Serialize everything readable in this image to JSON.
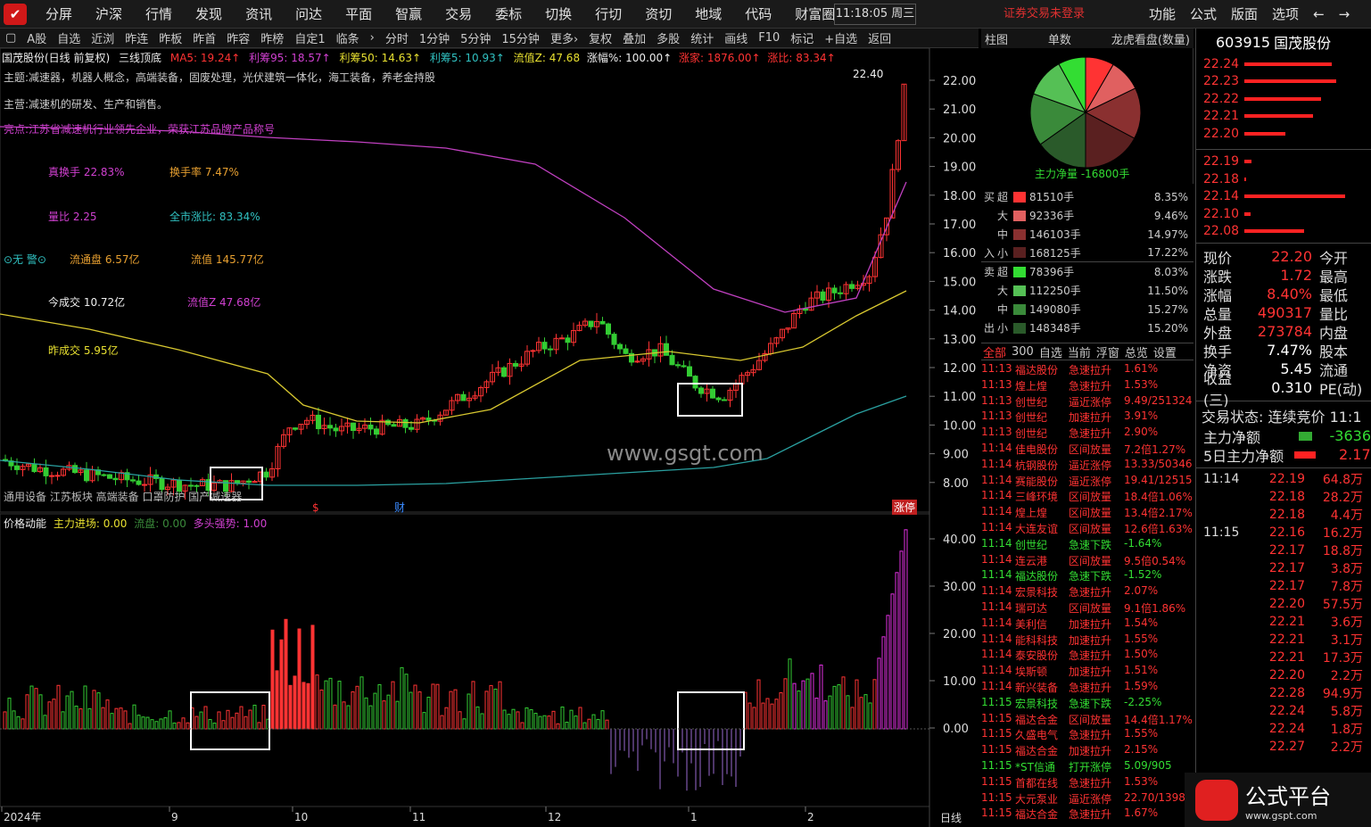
{
  "menubar": {
    "logo": "✔",
    "items": [
      "分屏",
      "沪深",
      "行情",
      "发现",
      "资讯",
      "问达",
      "平面",
      "智赢",
      "交易",
      "委标",
      "切换",
      "行切",
      "资切",
      "地域",
      "代码",
      "财富圈"
    ],
    "clock": "11:18:05 周三",
    "alert": "证券交易未登录",
    "right": [
      "功能",
      "公式",
      "版面",
      "选项",
      "←",
      "→"
    ]
  },
  "toolbar": {
    "items": [
      "▢",
      "A股",
      "自选",
      "近浏",
      "昨连",
      "昨板",
      "昨首",
      "昨容",
      "昨榜",
      "自定1",
      "临条",
      "›",
      "分时",
      "1分钟",
      "5分钟",
      "15分钟",
      "更多›",
      "复权",
      "叠加",
      "多股",
      "统计",
      "画线",
      "F10",
      "标记",
      "+自选",
      "返回"
    ]
  },
  "right_tabs": {
    "a": "柱图",
    "b": "单数",
    "c": "龙虎看盘(数量)"
  },
  "chart": {
    "title": "国茂股份(日线 前复权)",
    "indicator": "三线顶底",
    "ma5": "MA5: 19.24↑",
    "lc95": "利筹95: 18.57↑",
    "lc50": "利筹50: 14.63↑",
    "lc5": "利筹5: 10.93↑",
    "ltz": "流值Z: 47.68",
    "zf": "涨幅%: 100.00↑",
    "zj": "涨家: 1876.00↑",
    "zb": "涨比: 83.34↑",
    "theme": "主题:减速器，机器人概念，高端装备，固废处理，光伏建筑一体化，海工装备，养老金持股",
    "business": "主营:减速机的研发、生产和销售。",
    "highlight": "亮点:江苏省减速机行业领先企业，荣获江苏品牌产品称号",
    "zhs": "真换手 22.83%",
    "hsl": "换手率 7.47%",
    "lb": "量比 2.25",
    "qszb": "全市涨比: 83.34%",
    "wj": "⊙无 警⊙",
    "ltp": "流通盘 6.57亿",
    "lz": "流值 145.77亿",
    "jcj": "今成交 10.72亿",
    "lzz": "流值Z 47.68亿",
    "zcj": "昨成交 5.95亿",
    "bottom_label": "通用设备 江苏板块 高端装备 口罩防护 国产减速器",
    "price_max": "22.40",
    "dollar": "$",
    "cai": "财",
    "zt": "涨停",
    "indicator2_name": "价格动能",
    "zljc": "主力进场: 0.00",
    "lp": "流盘: 0.00",
    "dtqs": "多头强势: 1.00",
    "xaxis": [
      "2024年",
      "9",
      "10",
      "11",
      "12",
      "1",
      "2"
    ],
    "period": "日线",
    "yticks": [
      "22.00",
      "21.00",
      "20.00",
      "19.00",
      "18.00",
      "17.00",
      "16.00",
      "15.00",
      "14.00",
      "13.00",
      "12.00",
      "11.00",
      "10.00",
      "9.00",
      "8.00"
    ],
    "yticks2": [
      "40.00",
      "30.00",
      "20.00",
      "10.00",
      "0.00"
    ],
    "watermark": "www.gsgt.com"
  },
  "pie": {
    "caption": "主力净量 -16800手"
  },
  "flow": [
    {
      "side": "买",
      "lv": "超",
      "vol": "81510手",
      "pct": "8.35%",
      "color": "#ff3333"
    },
    {
      "side": "",
      "lv": "大",
      "vol": "92336手",
      "pct": "9.46%",
      "color": "#e06060"
    },
    {
      "side": "",
      "lv": "中",
      "vol": "146103手",
      "pct": "14.97%",
      "color": "#8a3030"
    },
    {
      "side": "入",
      "lv": "小",
      "vol": "168125手",
      "pct": "17.22%",
      "color": "#5a2020"
    },
    {
      "side": "卖",
      "lv": "超",
      "vol": "78396手",
      "pct": "8.03%",
      "color": "#33dd33"
    },
    {
      "side": "",
      "lv": "大",
      "vol": "112250手",
      "pct": "11.50%",
      "color": "#55c055"
    },
    {
      "side": "",
      "lv": "中",
      "vol": "149080手",
      "pct": "15.27%",
      "color": "#3a8a3a"
    },
    {
      "side": "出",
      "lv": "小",
      "vol": "148348手",
      "pct": "15.20%",
      "color": "#2a5a2a"
    }
  ],
  "stock_tabs": [
    "全部",
    "300",
    "自选",
    "当前",
    "浮窗",
    "总览",
    "设置"
  ],
  "news": [
    {
      "t": "11:13",
      "n": "福达股份",
      "a": "急速拉升",
      "v": "1.61%",
      "up": true
    },
    {
      "t": "11:13",
      "n": "煌上煌",
      "a": "急速拉升",
      "v": "1.53%",
      "up": true
    },
    {
      "t": "11:13",
      "n": "创世纪",
      "a": "逼近涨停",
      "v": "9.49/251324",
      "up": true
    },
    {
      "t": "11:13",
      "n": "创世纪",
      "a": "加速拉升",
      "v": "3.91%",
      "up": true
    },
    {
      "t": "11:13",
      "n": "创世纪",
      "a": "急速拉升",
      "v": "2.90%",
      "up": true
    },
    {
      "t": "11:14",
      "n": "佳电股份",
      "a": "区间放量",
      "v": "7.2倍1.27%",
      "up": true
    },
    {
      "t": "11:14",
      "n": "杭钢股份",
      "a": "逼近涨停",
      "v": "13.33/50346",
      "up": true
    },
    {
      "t": "11:14",
      "n": "赛能股份",
      "a": "逼近涨停",
      "v": "19.41/12515",
      "up": true
    },
    {
      "t": "11:14",
      "n": "三峰环境",
      "a": "区间放量",
      "v": "18.4倍1.06%",
      "up": true
    },
    {
      "t": "11:14",
      "n": "煌上煌",
      "a": "区间放量",
      "v": "13.4倍2.17%",
      "up": true
    },
    {
      "t": "11:14",
      "n": "大连友谊",
      "a": "区间放量",
      "v": "12.6倍1.63%",
      "up": true
    },
    {
      "t": "11:14",
      "n": "创世纪",
      "a": "急速下跌",
      "v": "-1.64%",
      "up": false
    },
    {
      "t": "11:14",
      "n": "连云港",
      "a": "区间放量",
      "v": "9.5倍0.54%",
      "up": true
    },
    {
      "t": "11:14",
      "n": "福达股份",
      "a": "急速下跌",
      "v": "-1.52%",
      "up": false
    },
    {
      "t": "11:14",
      "n": "宏景科技",
      "a": "急速拉升",
      "v": "2.07%",
      "up": true
    },
    {
      "t": "11:14",
      "n": "瑞可达",
      "a": "区间放量",
      "v": "9.1倍1.86%",
      "up": true
    },
    {
      "t": "11:14",
      "n": "美利信",
      "a": "加速拉升",
      "v": "1.54%",
      "up": true
    },
    {
      "t": "11:14",
      "n": "能科科技",
      "a": "加速拉升",
      "v": "1.55%",
      "up": true
    },
    {
      "t": "11:14",
      "n": "泰安股份",
      "a": "急速拉升",
      "v": "1.50%",
      "up": true
    },
    {
      "t": "11:14",
      "n": "埃斯顿",
      "a": "加速拉升",
      "v": "1.51%",
      "up": true
    },
    {
      "t": "11:14",
      "n": "新兴装备",
      "a": "急速拉升",
      "v": "1.59%",
      "up": true
    },
    {
      "t": "11:15",
      "n": "宏景科技",
      "a": "急速下跌",
      "v": "-2.25%",
      "up": false
    },
    {
      "t": "11:15",
      "n": "福达合金",
      "a": "区间放量",
      "v": "14.4倍1.17%",
      "up": true
    },
    {
      "t": "11:15",
      "n": "久盛电气",
      "a": "急速拉升",
      "v": "1.55%",
      "up": true
    },
    {
      "t": "11:15",
      "n": "福达合金",
      "a": "加速拉升",
      "v": "2.15%",
      "up": true
    },
    {
      "t": "11:15",
      "n": "*ST信通",
      "a": "打开涨停",
      "v": "5.09/905",
      "up": false
    },
    {
      "t": "11:15",
      "n": "首都在线",
      "a": "急速拉升",
      "v": "1.53%",
      "up": true
    },
    {
      "t": "11:15",
      "n": "大元泵业",
      "a": "逼近涨停",
      "v": "22.70/1398",
      "up": true
    },
    {
      "t": "11:15",
      "n": "福达合金",
      "a": "急速拉升",
      "v": "1.67%",
      "up": true
    }
  ],
  "quote": {
    "code": "603915",
    "name": "国茂股份",
    "asks": [
      {
        "p": "22.24",
        "w": 0.82
      },
      {
        "p": "22.23",
        "w": 0.86
      },
      {
        "p": "22.22",
        "w": 0.72
      },
      {
        "p": "22.21",
        "w": 0.64
      },
      {
        "p": "22.20",
        "w": 0.38
      }
    ],
    "bids": [
      {
        "p": "22.19",
        "w": 0.07
      },
      {
        "p": "22.18",
        "w": 0.02
      },
      {
        "p": "22.14",
        "w": 0.94
      },
      {
        "p": "22.10",
        "w": 0.06
      },
      {
        "p": "22.08",
        "w": 0.56
      }
    ],
    "kv": [
      {
        "k": "现价",
        "v": "22.20",
        "k2": "今开"
      },
      {
        "k": "涨跌",
        "v": "1.72",
        "k2": "最高"
      },
      {
        "k": "涨幅",
        "v": "8.40%",
        "k2": "最低"
      },
      {
        "k": "总量",
        "v": "490317",
        "k2": "量比"
      },
      {
        "k": "外盘",
        "v": "273784",
        "k2": "内盘"
      },
      {
        "k": "换手",
        "v": "7.47%",
        "k2": "股本"
      },
      {
        "k": "净资",
        "v": "5.45",
        "k2": "流通"
      },
      {
        "k": "收益(三)",
        "v": "0.310",
        "k2": "PE(动)"
      }
    ],
    "state": "交易状态: 连续竞价 11:1",
    "zl1": "主力净额",
    "zl1v": "-3636",
    "zl2": "5日主力净额",
    "zl2v": "2.17",
    "ticks": [
      {
        "t": "11:14",
        "p": "22.19",
        "v": "64.8万"
      },
      {
        "t": "",
        "p": "22.18",
        "v": "28.2万"
      },
      {
        "t": "",
        "p": "22.18",
        "v": "4.4万"
      },
      {
        "t": "11:15",
        "p": "22.16",
        "v": "16.2万"
      },
      {
        "t": "",
        "p": "22.17",
        "v": "18.8万"
      },
      {
        "t": "",
        "p": "22.17",
        "v": "3.8万"
      },
      {
        "t": "",
        "p": "22.17",
        "v": "7.8万"
      },
      {
        "t": "",
        "p": "22.20",
        "v": "57.5万"
      },
      {
        "t": "",
        "p": "22.21",
        "v": "3.6万"
      },
      {
        "t": "",
        "p": "22.21",
        "v": "3.1万"
      },
      {
        "t": "",
        "p": "22.21",
        "v": "17.3万"
      },
      {
        "t": "",
        "p": "22.20",
        "v": "2.2万"
      },
      {
        "t": "",
        "p": "22.28",
        "v": "94.9万"
      },
      {
        "t": "",
        "p": "22.24",
        "v": "5.8万"
      },
      {
        "t": "",
        "p": "22.24",
        "v": "1.8万"
      },
      {
        "t": "",
        "p": "22.27",
        "v": "2.2万"
      }
    ]
  },
  "brand": {
    "title": "公式平台",
    "url": "www.gspt.com"
  }
}
